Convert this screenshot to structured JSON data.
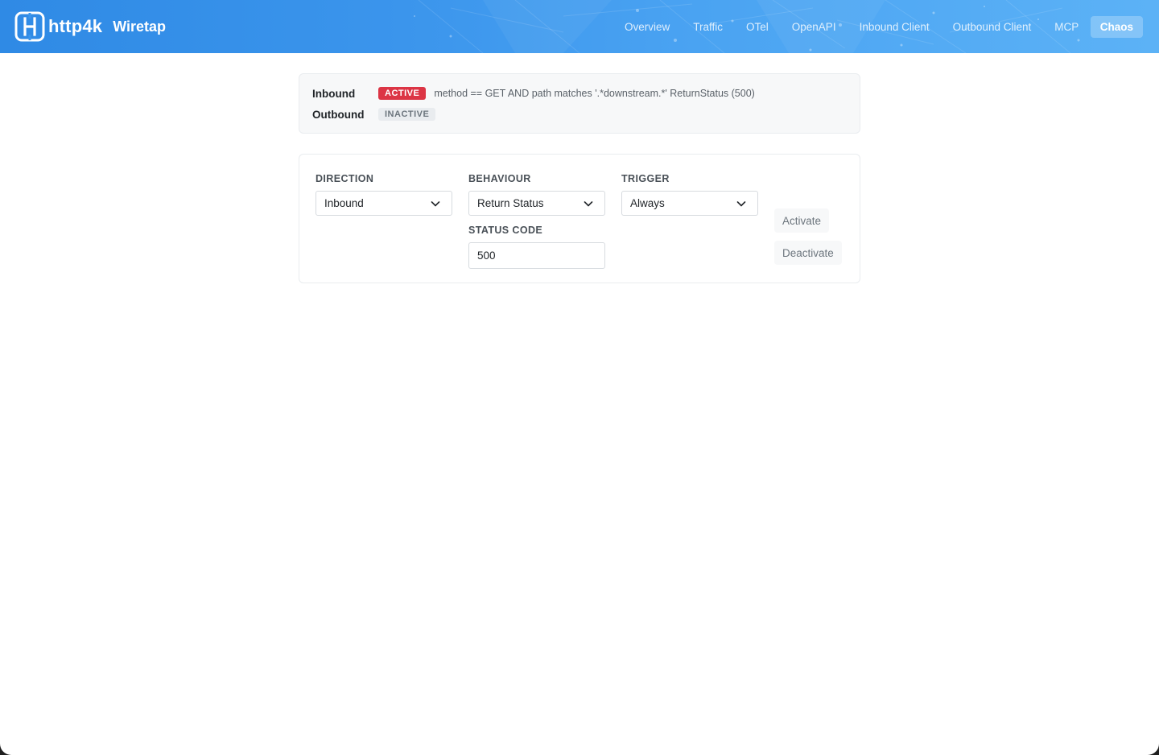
{
  "header": {
    "brand": "http4k",
    "subtitle": "Wiretap",
    "nav": [
      {
        "label": "Overview"
      },
      {
        "label": "Traffic"
      },
      {
        "label": "OTel"
      },
      {
        "label": "OpenAPI"
      },
      {
        "label": "Inbound Client"
      },
      {
        "label": "Outbound Client"
      },
      {
        "label": "MCP"
      },
      {
        "label": "Chaos",
        "active": true
      }
    ],
    "colors": {
      "accent": "#3b95ec"
    }
  },
  "status": {
    "rows": [
      {
        "direction": "Inbound",
        "badge": "ACTIVE",
        "description": "method == GET AND path matches '.*downstream.*' ReturnStatus (500)"
      },
      {
        "direction": "Outbound",
        "badge": "INACTIVE",
        "description": ""
      }
    ],
    "colors": {
      "active": "#dc3545",
      "inactive": "#e9ecef"
    }
  },
  "form": {
    "direction": {
      "label": "DIRECTION",
      "value": "Inbound"
    },
    "behaviour": {
      "label": "BEHAVIOUR",
      "value": "Return Status"
    },
    "trigger": {
      "label": "TRIGGER",
      "value": "Always"
    },
    "status_code": {
      "label": "STATUS CODE",
      "value": "500"
    },
    "activate_label": "Activate",
    "deactivate_label": "Deactivate"
  }
}
